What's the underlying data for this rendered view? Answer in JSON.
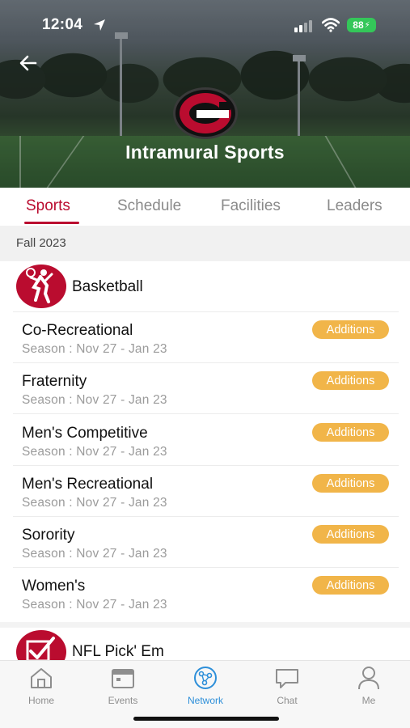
{
  "status": {
    "time": "12:04",
    "battery": "88"
  },
  "header": {
    "title": "Intramural Sports"
  },
  "tabs": [
    {
      "label": "Sports"
    },
    {
      "label": "Schedule"
    },
    {
      "label": "Facilities"
    },
    {
      "label": "Leaders"
    }
  ],
  "term": "Fall 2023",
  "sports": [
    {
      "name": "Basketball",
      "leagues": [
        {
          "title": "Co-Recreational",
          "season": "Season : Nov 27 - Jan 23",
          "badge": "Additions"
        },
        {
          "title": "Fraternity",
          "season": "Season : Nov 27 - Jan 23",
          "badge": "Additions"
        },
        {
          "title": "Men's Competitive",
          "season": "Season : Nov 27 - Jan 23",
          "badge": "Additions"
        },
        {
          "title": "Men's Recreational",
          "season": "Season : Nov 27 - Jan 23",
          "badge": "Additions"
        },
        {
          "title": "Sorority",
          "season": "Season : Nov 27 - Jan 23",
          "badge": "Additions"
        },
        {
          "title": "Women's",
          "season": "Season : Nov 27 - Jan 23",
          "badge": "Additions"
        }
      ]
    },
    {
      "name": "NFL Pick' Em"
    }
  ],
  "nav": [
    {
      "label": "Home",
      "icon": "home-icon"
    },
    {
      "label": "Events",
      "icon": "calendar-icon"
    },
    {
      "label": "Network",
      "icon": "network-icon"
    },
    {
      "label": "Chat",
      "icon": "chat-icon"
    },
    {
      "label": "Me",
      "icon": "person-icon"
    }
  ],
  "colors": {
    "accent": "#ba0c2f",
    "badge": "#f1b549",
    "nav_active": "#2d8fd9",
    "battery": "#34c759"
  }
}
